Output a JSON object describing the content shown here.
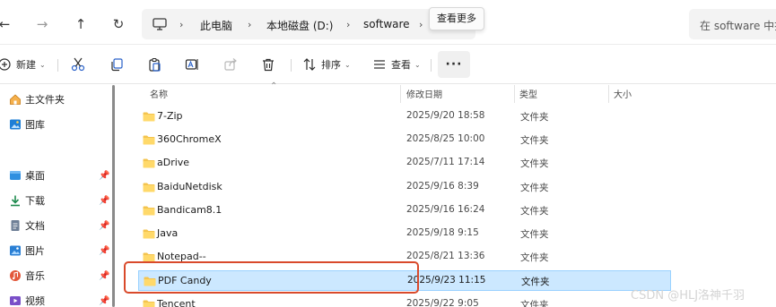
{
  "address_bar": {
    "back": "←",
    "forward": "→",
    "up": "↑",
    "refresh": "↻",
    "breadcrumbs": [
      "此电脑",
      "本地磁盘 (D:)",
      "software"
    ],
    "tooltip": "查看更多",
    "search_placeholder": "在 software 中搜索"
  },
  "command_bar": {
    "new": "新建",
    "sort": "排序",
    "view": "查看",
    "more": "···"
  },
  "sidebar": {
    "items": [
      {
        "label": "主文件夹",
        "icon": "home-icon",
        "pinned": false
      },
      {
        "label": "图库",
        "icon": "gallery-icon",
        "pinned": false
      },
      {
        "label": "桌面",
        "icon": "desktop-icon",
        "pinned": true
      },
      {
        "label": "下载",
        "icon": "download-icon",
        "pinned": true
      },
      {
        "label": "文档",
        "icon": "document-icon",
        "pinned": true
      },
      {
        "label": "图片",
        "icon": "pictures-icon",
        "pinned": true
      },
      {
        "label": "音乐",
        "icon": "music-icon",
        "pinned": true
      },
      {
        "label": "视频",
        "icon": "video-icon",
        "pinned": true
      }
    ]
  },
  "file_list": {
    "columns": [
      "名称",
      "修改日期",
      "类型",
      "大小"
    ],
    "rows": [
      {
        "name": "7-Zip",
        "date": "2025/9/20 18:58",
        "type": "文件夹",
        "selected": false
      },
      {
        "name": "360ChromeX",
        "date": "2025/8/25 10:00",
        "type": "文件夹",
        "selected": false
      },
      {
        "name": "aDrive",
        "date": "2025/7/11 17:14",
        "type": "文件夹",
        "selected": false
      },
      {
        "name": "BaiduNetdisk",
        "date": "2025/9/16 8:39",
        "type": "文件夹",
        "selected": false
      },
      {
        "name": "Bandicam8.1",
        "date": "2025/9/16 16:24",
        "type": "文件夹",
        "selected": false
      },
      {
        "name": "Java",
        "date": "2025/9/18 9:15",
        "type": "文件夹",
        "selected": false
      },
      {
        "name": "Notepad--",
        "date": "2025/8/21 13:36",
        "type": "文件夹",
        "selected": false
      },
      {
        "name": "PDF Candy",
        "date": "2025/9/23 11:15",
        "type": "文件夹",
        "selected": true
      },
      {
        "name": "Tencent",
        "date": "2025/9/22 9:05",
        "type": "文件夹",
        "selected": false
      }
    ]
  },
  "watermark": "CSDN @HLJ洛神千羽",
  "colors": {
    "selection": "#cce8ff",
    "highlight_box": "#d94a2b",
    "folder": "#f4c44e"
  }
}
